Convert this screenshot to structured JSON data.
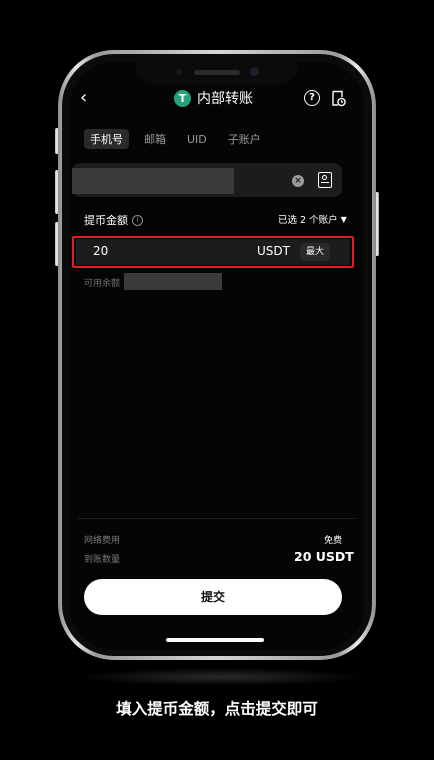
{
  "header": {
    "title": "内部转账",
    "token_logo_letter": "T",
    "back_icon": "chevron-left-icon",
    "help_icon": "question-circle-icon",
    "history_icon": "document-clock-icon",
    "token_color": "#26a17b"
  },
  "tabs": [
    {
      "label": "手机号",
      "active": true
    },
    {
      "label": "邮箱",
      "active": false
    },
    {
      "label": "UID",
      "active": false
    },
    {
      "label": "子账户",
      "active": false
    }
  ],
  "recipient": {
    "value": "",
    "clear_icon": "clear-circle-icon",
    "contact_icon": "contact-book-icon"
  },
  "amount": {
    "label": "提币金额",
    "info_icon": "info-icon",
    "account_select": "已选 2 个账户",
    "value": "20",
    "currency": "USDT",
    "max_label": "最大",
    "available_label": "可用余额",
    "highlight_color": "#e11d1d"
  },
  "summary": {
    "fee_label": "网络费用",
    "fee_value": "免费",
    "receive_label": "到账数量",
    "receive_value": "20 USDT"
  },
  "submit_label": "提交",
  "caption": "填入提币金额，点击提交即可"
}
